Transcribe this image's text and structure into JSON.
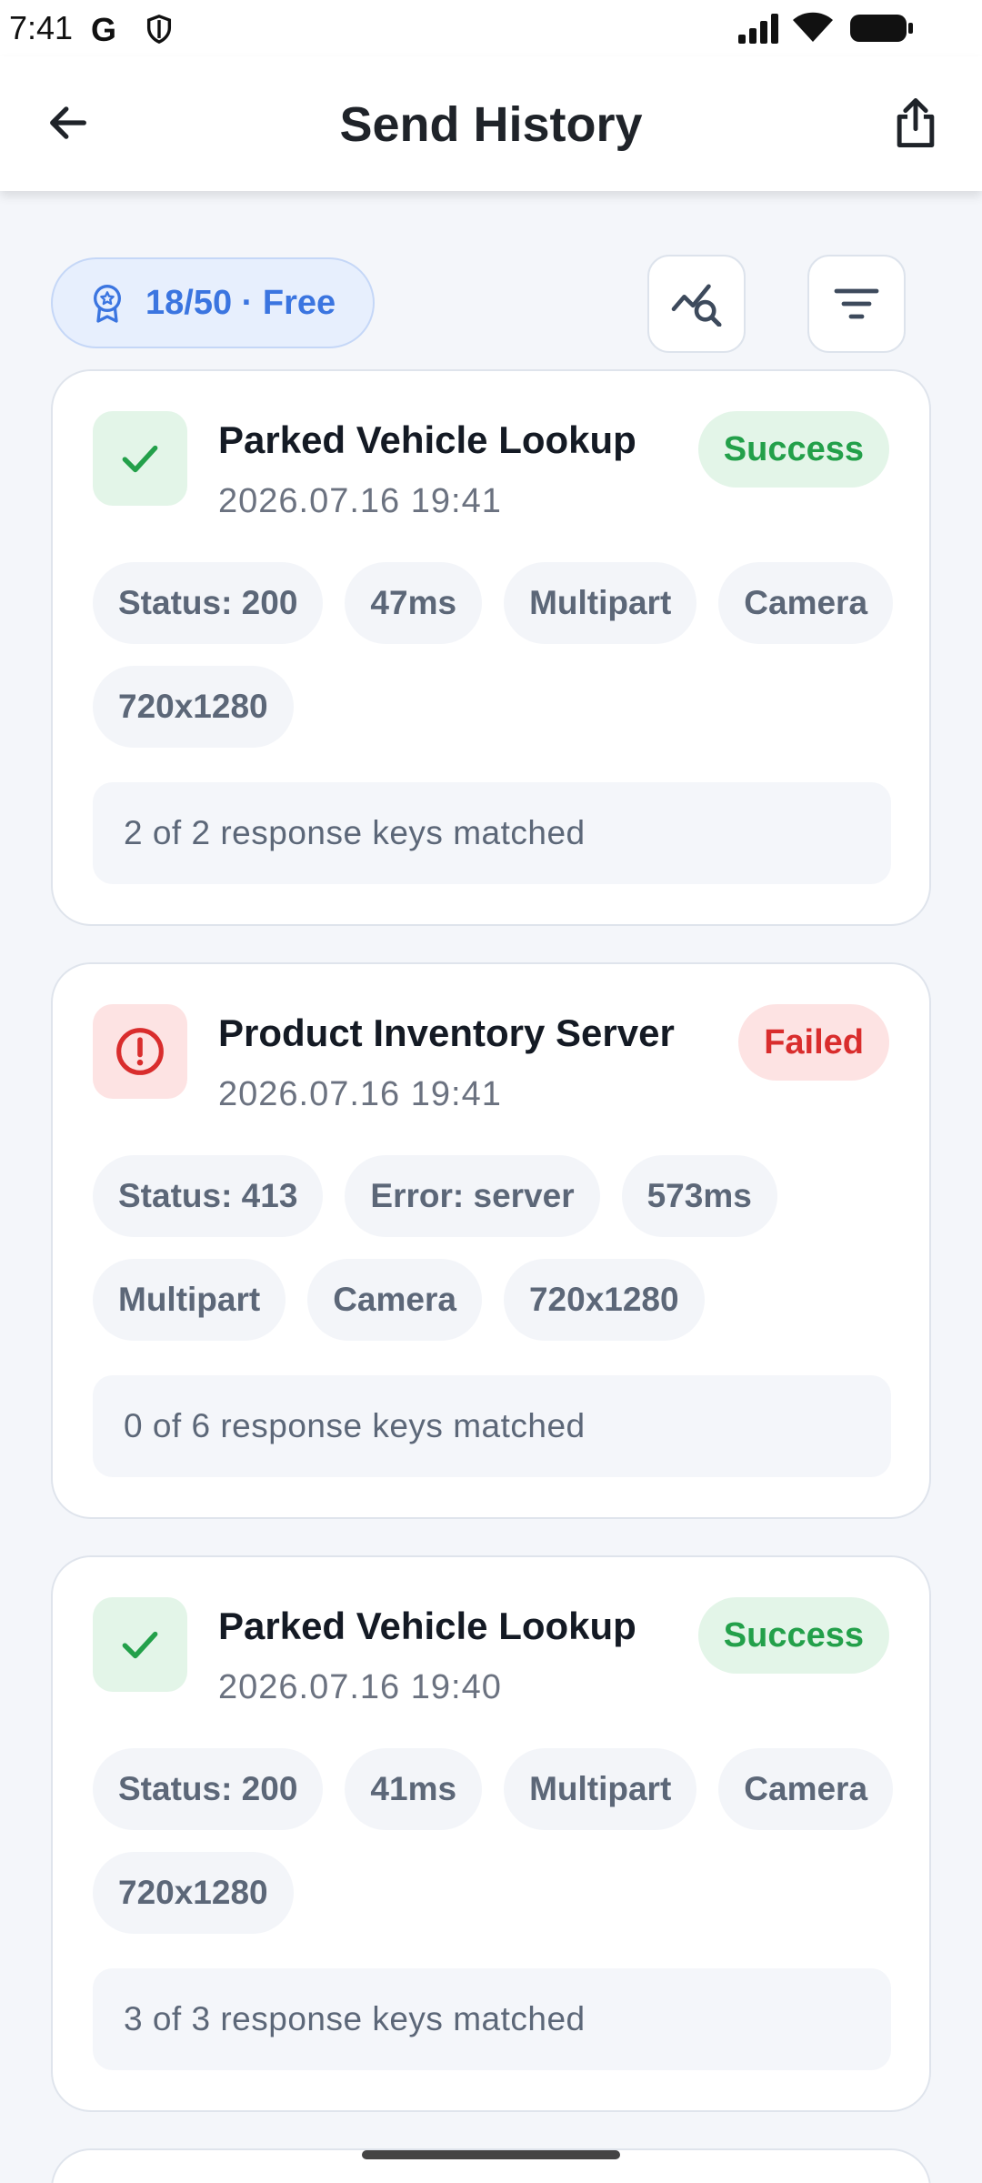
{
  "status_bar": {
    "time": "7:41",
    "g_label": "G",
    "icons": [
      "google-icon",
      "shield-icon",
      "signal-icon",
      "wifi-icon",
      "battery-icon"
    ]
  },
  "header": {
    "title": "Send History",
    "back_icon": "arrow-left-icon",
    "share_icon": "share-icon"
  },
  "toolbar": {
    "quota_label": "18/50 · Free",
    "quota_icon": "award-badge-icon",
    "analytics_icon": "chart-search-icon",
    "filter_icon": "filter-icon"
  },
  "colors": {
    "accent": "#3b75e0",
    "success": "#23a04a",
    "failed": "#d92d2d",
    "background": "#f4f6fa"
  },
  "records": [
    {
      "title": "Parked Vehicle Lookup",
      "timestamp": "2026.07.16 19:41",
      "status": "Success",
      "status_icon": "check-icon",
      "chips": [
        "Status: 200",
        "47ms",
        "Multipart",
        "Camera",
        "720x1280"
      ],
      "match_text": "2 of 2 response keys matched"
    },
    {
      "title": "Product Inventory Server",
      "timestamp": "2026.07.16 19:41",
      "status": "Failed",
      "status_icon": "alert-circle-icon",
      "chips": [
        "Status: 413",
        "Error: server",
        "573ms",
        "Multipart",
        "Camera",
        "720x1280"
      ],
      "match_text": "0 of 6 response keys matched"
    },
    {
      "title": "Parked Vehicle Lookup",
      "timestamp": "2026.07.16 19:40",
      "status": "Success",
      "status_icon": "check-icon",
      "chips": [
        "Status: 200",
        "41ms",
        "Multipart",
        "Camera",
        "720x1280"
      ],
      "match_text": "3 of 3 response keys matched"
    }
  ]
}
